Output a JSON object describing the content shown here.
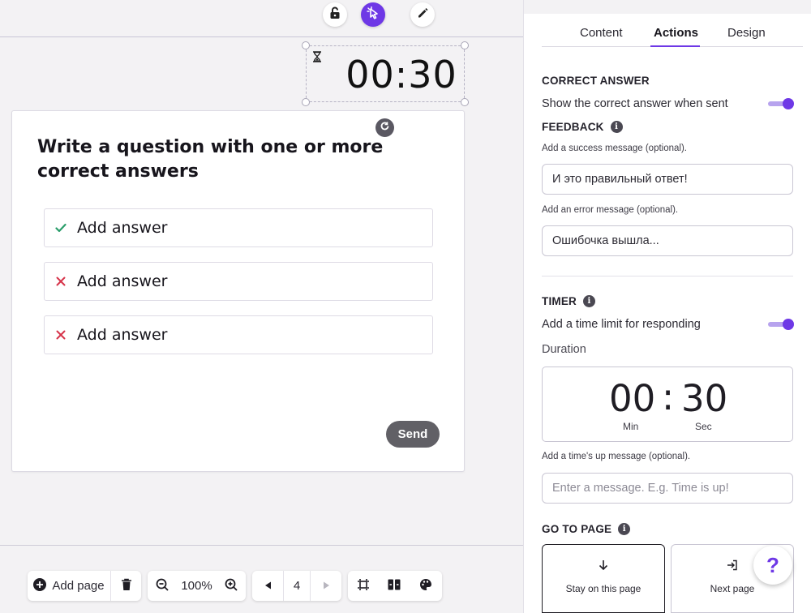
{
  "canvas": {
    "timer_value": "00:30",
    "question": "Write a question with one or more correct answers",
    "answers": [
      {
        "label": "Add answer",
        "state": "correct"
      },
      {
        "label": "Add answer",
        "state": "incorrect"
      },
      {
        "label": "Add answer",
        "state": "incorrect"
      }
    ],
    "send_label": "Send"
  },
  "toolbar": {
    "add_page_label": "Add page",
    "zoom_level": "100%",
    "page_number": "4"
  },
  "panel": {
    "tabs": [
      "Content",
      "Actions",
      "Design"
    ],
    "active_tab": "Actions",
    "correct_answer": {
      "title": "CORRECT ANSWER",
      "toggle_label": "Show the correct answer when sent",
      "enabled": true
    },
    "feedback": {
      "title": "FEEDBACK",
      "success_label": "Add a success message (optional).",
      "success_value": "И это правильный ответ!",
      "error_label": "Add an error message (optional).",
      "error_value": "Ошибочка вышла..."
    },
    "timer": {
      "title": "TIMER",
      "toggle_label": "Add a time limit for responding",
      "enabled": true,
      "duration_label": "Duration",
      "minutes": "00",
      "seconds": "30",
      "min_unit": "Min",
      "sec_unit": "Sec",
      "timesup_label": "Add a time's up message (optional).",
      "timesup_placeholder": "Enter a message. E.g. Time is up!"
    },
    "goto_page": {
      "title": "GO TO PAGE",
      "options": [
        "Stay on this page",
        "Next page"
      ],
      "selected": "Stay on this page"
    }
  },
  "help_label": "?",
  "colors": {
    "accent": "#6e38e6",
    "correct": "#2a9d6a",
    "incorrect": "#d6334a",
    "send": "#616066"
  }
}
